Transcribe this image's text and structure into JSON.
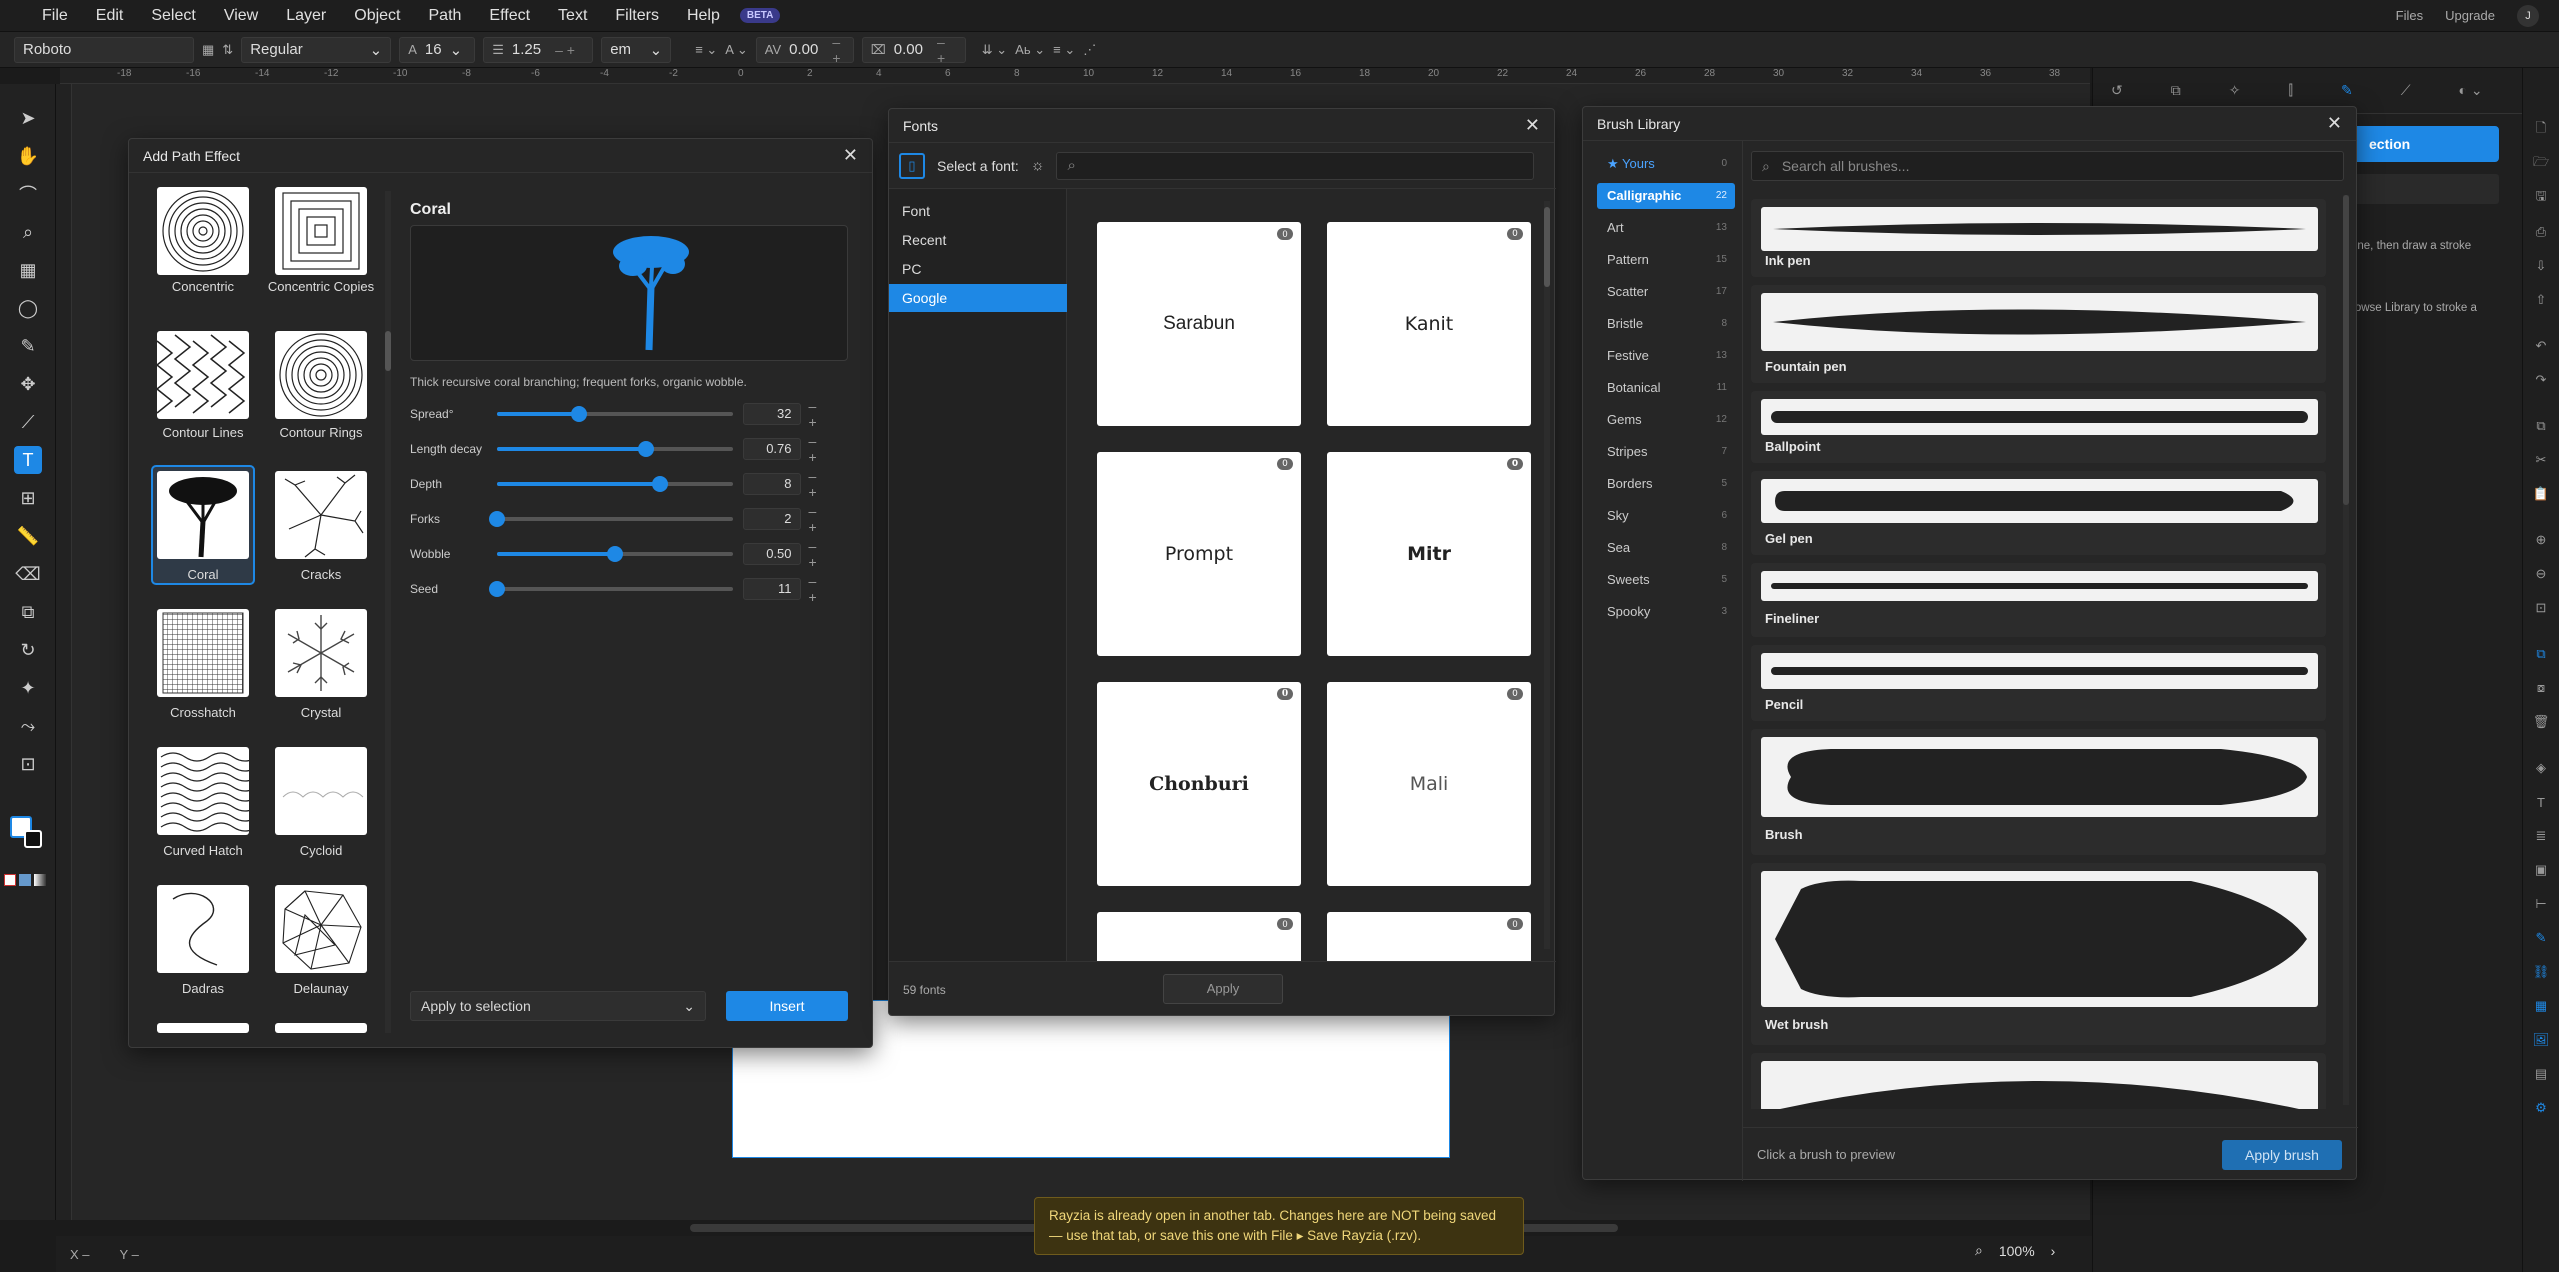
{
  "menu": {
    "items": [
      "File",
      "Edit",
      "Select",
      "View",
      "Layer",
      "Object",
      "Path",
      "Effect",
      "Text",
      "Filters",
      "Help"
    ],
    "beta": "BETA",
    "files": "Files",
    "upgrade": "Upgrade",
    "avatar": "J"
  },
  "toolbar": {
    "font_family": "Roboto",
    "font_style": "Regular",
    "font_size": "16",
    "line_height": "1.25",
    "unit": "em",
    "letter_spacing": "0.00",
    "word_spacing": "0.00"
  },
  "ruler": {
    "labels": [
      "-18",
      "-16",
      "-14",
      "-12",
      "-10",
      "-8",
      "-6",
      "-4",
      "-2",
      "0",
      "2",
      "4",
      "6",
      "8",
      "10",
      "12",
      "14",
      "16",
      "18",
      "20",
      "22",
      "24",
      "26",
      "28",
      "30",
      "32",
      "34",
      "36",
      "38"
    ]
  },
  "path_effect": {
    "title": "Add Path Effect",
    "effects": [
      {
        "label": "Concentric"
      },
      {
        "label": "Concentric Copies"
      },
      {
        "label": "Contour Lines"
      },
      {
        "label": "Contour Rings"
      },
      {
        "label": "Coral"
      },
      {
        "label": "Cracks"
      },
      {
        "label": "Crosshatch"
      },
      {
        "label": "Crystal"
      },
      {
        "label": "Curved Hatch"
      },
      {
        "label": "Cycloid"
      },
      {
        "label": "Dadras"
      },
      {
        "label": "Delaunay"
      }
    ],
    "selected": {
      "name": "Coral",
      "description": "Thick recursive coral branching; frequent forks, organic wobble."
    },
    "params": [
      {
        "label": "Spread°",
        "value": "32",
        "level": 0.35
      },
      {
        "label": "Length decay",
        "value": "0.76",
        "level": 0.63
      },
      {
        "label": "Depth",
        "value": "8",
        "level": 0.69
      },
      {
        "label": "Forks",
        "value": "2",
        "level": 0.0
      },
      {
        "label": "Wobble",
        "value": "0.50",
        "level": 0.5
      },
      {
        "label": "Seed",
        "value": "11",
        "level": 0.0
      }
    ],
    "apply_mode": "Apply to selection",
    "insert_label": "Insert"
  },
  "fonts": {
    "title": "Fonts",
    "select_label": "Select a font:",
    "nav": [
      "Font",
      "Recent",
      "PC",
      "Google"
    ],
    "selected_nav": "Google",
    "cards": [
      {
        "name": "Sarabun",
        "badge": "0"
      },
      {
        "name": "Kanit",
        "badge": "0"
      },
      {
        "name": "Prompt",
        "badge": "0"
      },
      {
        "name": "Mitr",
        "badge": "0"
      },
      {
        "name": "Chonburi",
        "badge": "0"
      },
      {
        "name": "Mali",
        "badge": "0"
      },
      {
        "name": "",
        "badge": "0"
      },
      {
        "name": "",
        "badge": "0"
      }
    ],
    "count": "59 fonts",
    "apply_label": "Apply"
  },
  "brushes": {
    "title": "Brush Library",
    "search_placeholder": "Search all brushes...",
    "categories": [
      {
        "label": "★ Yours",
        "count": "0"
      },
      {
        "label": "Calligraphic",
        "count": "22"
      },
      {
        "label": "Art",
        "count": "13"
      },
      {
        "label": "Pattern",
        "count": "15"
      },
      {
        "label": "Scatter",
        "count": "17"
      },
      {
        "label": "Bristle",
        "count": "8"
      },
      {
        "label": "Festive",
        "count": "13"
      },
      {
        "label": "Botanical",
        "count": "11"
      },
      {
        "label": "Gems",
        "count": "12"
      },
      {
        "label": "Stripes",
        "count": "7"
      },
      {
        "label": "Borders",
        "count": "5"
      },
      {
        "label": "Sky",
        "count": "6"
      },
      {
        "label": "Sea",
        "count": "8"
      },
      {
        "label": "Sweets",
        "count": "5"
      },
      {
        "label": "Spooky",
        "count": "3"
      }
    ],
    "selected_category": "Calligraphic",
    "items": [
      {
        "name": "Ink pen"
      },
      {
        "name": "Fountain pen"
      },
      {
        "name": "Ballpoint"
      },
      {
        "name": "Gel pen"
      },
      {
        "name": "Fineliner"
      },
      {
        "name": "Pencil"
      },
      {
        "name": "Brush"
      },
      {
        "name": "Wet brush"
      }
    ],
    "hint": "Click a brush to preview",
    "apply_label": "Apply brush"
  },
  "right_panel": {
    "button": "ection",
    "hint1": "one, then draw a stroke",
    "hint2": "rowse Library to stroke a"
  },
  "status": {
    "x": "X –",
    "y": "Y –",
    "zoom": "100%"
  },
  "toast": {
    "line1": "Rayzia is already open in another tab. Changes here are NOT being saved",
    "line2": "— use that tab, or save this one with File ▸ Save Rayzia (.rzv)."
  }
}
